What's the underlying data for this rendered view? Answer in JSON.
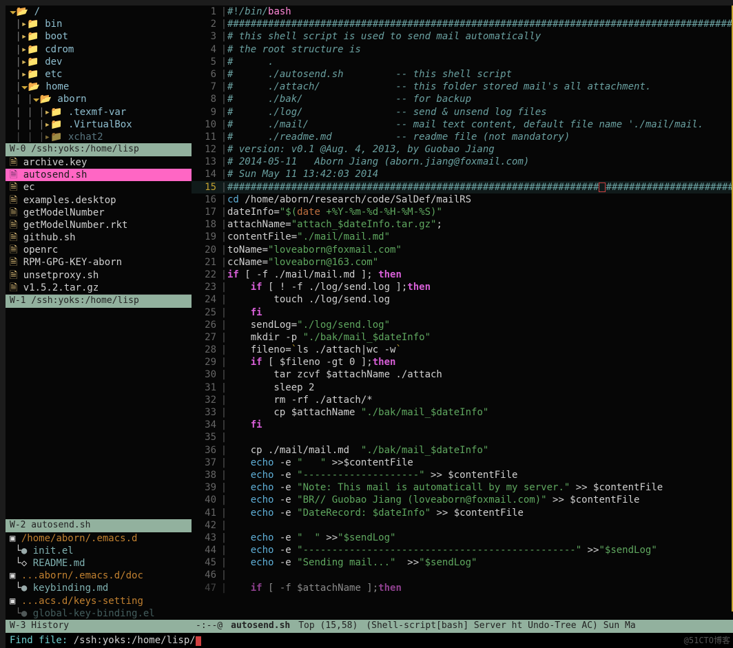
{
  "sidebar": {
    "w0_label": "W-0 /ssh:yoks:/home/lisp",
    "w1_label": "W-1 /ssh:yoks:/home/lisp",
    "w2_label": "W-2 autosend.sh",
    "w3_label": "W-3 History",
    "tree": [
      {
        "depth": 0,
        "icon": "open",
        "name": "/"
      },
      {
        "depth": 1,
        "icon": "closed",
        "name": "bin"
      },
      {
        "depth": 1,
        "icon": "closed",
        "name": "boot"
      },
      {
        "depth": 1,
        "icon": "closed",
        "name": "cdrom"
      },
      {
        "depth": 1,
        "icon": "closed",
        "name": "dev"
      },
      {
        "depth": 1,
        "icon": "closed",
        "name": "etc"
      },
      {
        "depth": 1,
        "icon": "open",
        "name": "home"
      },
      {
        "depth": 2,
        "icon": "open",
        "name": "aborn"
      },
      {
        "depth": 3,
        "icon": "closed",
        "name": ".texmf-var"
      },
      {
        "depth": 3,
        "icon": "closed",
        "name": ".VirtualBox"
      },
      {
        "depth": 3,
        "icon": "closed",
        "name": "xchat2",
        "cut": true
      }
    ],
    "files": [
      {
        "icon": "f",
        "name": "archive.key",
        "sel": false
      },
      {
        "icon": "f",
        "name": "autosend.sh",
        "sel": true
      },
      {
        "icon": "f",
        "name": "ec",
        "sel": false
      },
      {
        "icon": "f",
        "name": "examples.desktop",
        "sel": false
      },
      {
        "icon": "f",
        "name": "getModelNumber",
        "sel": false
      },
      {
        "icon": "f",
        "name": "getModelNumber.rkt",
        "sel": false
      },
      {
        "icon": "f",
        "name": "github.sh",
        "sel": false
      },
      {
        "icon": "f",
        "name": "openrc",
        "sel": false
      },
      {
        "icon": "f",
        "name": "RPM-GPG-KEY-aborn",
        "sel": false
      },
      {
        "icon": "f",
        "name": "unsetproxy.sh",
        "sel": false
      },
      {
        "icon": "f",
        "name": "v1.5.2.tar.gz",
        "sel": false,
        "cut": true
      }
    ],
    "history": [
      {
        "type": "dir",
        "text": "/home/aborn/.emacs.d"
      },
      {
        "type": "file",
        "icon": "dot",
        "text": "init.el"
      },
      {
        "type": "file",
        "icon": "doc",
        "text": "README.md"
      },
      {
        "type": "dir",
        "text": "...aborn/.emacs.d/doc"
      },
      {
        "type": "file",
        "icon": "dot",
        "text": "keybinding.md"
      },
      {
        "type": "dir",
        "text": "...acs.d/keys-setting"
      },
      {
        "type": "file",
        "icon": "dot",
        "text": "global-key-binding.el",
        "cut": true
      }
    ]
  },
  "editor": {
    "lines": [
      {
        "n": 1,
        "segs": [
          {
            "c": "c-hash",
            "t": "#!"
          },
          {
            "c": "c-comment",
            "t": "/bin/"
          },
          {
            "c": "c-mag",
            "t": "bash"
          }
        ]
      },
      {
        "n": 2,
        "segs": [
          {
            "c": "c-hash",
            "t": "#########################################################################################"
          }
        ]
      },
      {
        "n": 3,
        "segs": [
          {
            "c": "c-comment",
            "t": "# this shell script is used to send mail automatically"
          }
        ]
      },
      {
        "n": 4,
        "segs": [
          {
            "c": "c-comment",
            "t": "# the root structure is"
          }
        ]
      },
      {
        "n": 5,
        "segs": [
          {
            "c": "c-comment",
            "t": "#      ."
          }
        ]
      },
      {
        "n": 6,
        "segs": [
          {
            "c": "c-comment",
            "t": "#      ./autosend.sh         -- this shell script"
          }
        ]
      },
      {
        "n": 7,
        "segs": [
          {
            "c": "c-comment",
            "t": "#      ./attach/             -- this folder stored mail's all attachment."
          }
        ]
      },
      {
        "n": 8,
        "segs": [
          {
            "c": "c-comment",
            "t": "#      ./bak/                -- for backup"
          }
        ]
      },
      {
        "n": 9,
        "segs": [
          {
            "c": "c-comment",
            "t": "#      ./log/                -- send & unsend log files"
          }
        ]
      },
      {
        "n": 10,
        "segs": [
          {
            "c": "c-comment",
            "t": "#      ./mail/               -- mail text content, default file name './mail/mail."
          }
        ]
      },
      {
        "n": 11,
        "segs": [
          {
            "c": "c-comment",
            "t": "#      ./readme.md           -- readme file (not mandatory)"
          }
        ]
      },
      {
        "n": 12,
        "segs": [
          {
            "c": "c-comment",
            "t": "# version: v0.1 @Aug. 4, 2013, by Guobao Jiang"
          }
        ]
      },
      {
        "n": 13,
        "segs": [
          {
            "c": "c-comment",
            "t": "# 2014-05-11   Aborn Jiang (aborn.jiang@foxmail.com)"
          }
        ]
      },
      {
        "n": 14,
        "segs": [
          {
            "c": "c-comment",
            "t": "# Sun May 11 13:42:03 2014"
          }
        ]
      },
      {
        "n": 15,
        "hl": true,
        "segs": [
          {
            "c": "c-hash",
            "t": "################################################################"
          },
          {
            "c": "",
            "t": "",
            "redbox": true
          },
          {
            "c": "c-hash",
            "t": "#########################"
          }
        ]
      },
      {
        "n": 16,
        "segs": [
          {
            "c": "c-fn",
            "t": "cd"
          },
          {
            "c": "",
            "t": " /home/aborn/research/code/SalDef/mailRS"
          }
        ]
      },
      {
        "n": 17,
        "segs": [
          {
            "c": "c-var",
            "t": "dateInfo="
          },
          {
            "c": "c-str",
            "t": "\"$("
          },
          {
            "c": "c-orange",
            "t": "date"
          },
          {
            "c": "c-str",
            "t": " +%Y-%m-%d-%H-%M-%S)\""
          }
        ]
      },
      {
        "n": 18,
        "segs": [
          {
            "c": "c-var",
            "t": "attachName="
          },
          {
            "c": "c-str",
            "t": "\"attach_$dateInfo.tar.gz\""
          },
          {
            "c": "",
            "t": ";"
          }
        ]
      },
      {
        "n": 19,
        "segs": [
          {
            "c": "c-var",
            "t": "contentFile="
          },
          {
            "c": "c-str",
            "t": "\"./mail/mail.md\""
          }
        ]
      },
      {
        "n": 20,
        "segs": [
          {
            "c": "c-var",
            "t": "toName="
          },
          {
            "c": "c-str",
            "t": "\"loveaborn@foxmail.com\""
          }
        ]
      },
      {
        "n": 21,
        "segs": [
          {
            "c": "c-var",
            "t": "ccName="
          },
          {
            "c": "c-str",
            "t": "\"loveaborn@163.com\""
          }
        ]
      },
      {
        "n": 22,
        "segs": [
          {
            "c": "c-kw",
            "t": "if"
          },
          {
            "c": "",
            "t": " [ -f ./mail/mail.md ]; "
          },
          {
            "c": "c-kw",
            "t": "then"
          }
        ]
      },
      {
        "n": 23,
        "segs": [
          {
            "c": "",
            "t": "    "
          },
          {
            "c": "c-kw",
            "t": "if"
          },
          {
            "c": "",
            "t": " [ ! -f ./log/send.log ];"
          },
          {
            "c": "c-kw",
            "t": "then"
          }
        ]
      },
      {
        "n": 24,
        "segs": [
          {
            "c": "",
            "t": "        touch ./log/send.log"
          }
        ]
      },
      {
        "n": 25,
        "segs": [
          {
            "c": "",
            "t": "    "
          },
          {
            "c": "c-kw",
            "t": "fi"
          }
        ]
      },
      {
        "n": 26,
        "segs": [
          {
            "c": "",
            "t": "    sendLog="
          },
          {
            "c": "c-str",
            "t": "\"./log/send.log\""
          }
        ]
      },
      {
        "n": 27,
        "segs": [
          {
            "c": "",
            "t": "    mkdir -p "
          },
          {
            "c": "c-str",
            "t": "\"./bak/mail_$dateInfo\""
          }
        ]
      },
      {
        "n": 28,
        "segs": [
          {
            "c": "",
            "t": "    fileno="
          },
          {
            "c": "c-yellow",
            "t": "`"
          },
          {
            "c": "",
            "t": "ls ./attach|wc -w"
          },
          {
            "c": "c-yellow",
            "t": "`"
          }
        ]
      },
      {
        "n": 29,
        "segs": [
          {
            "c": "",
            "t": "    "
          },
          {
            "c": "c-kw",
            "t": "if"
          },
          {
            "c": "",
            "t": " [ $fileno -gt 0 ];"
          },
          {
            "c": "c-kw",
            "t": "then"
          }
        ]
      },
      {
        "n": 30,
        "segs": [
          {
            "c": "",
            "t": "        tar zcvf $attachName ./attach"
          }
        ]
      },
      {
        "n": 31,
        "segs": [
          {
            "c": "",
            "t": "        sleep 2"
          }
        ]
      },
      {
        "n": 32,
        "segs": [
          {
            "c": "",
            "t": "        rm -rf ./attach/*"
          }
        ]
      },
      {
        "n": 33,
        "segs": [
          {
            "c": "",
            "t": "        cp $attachName "
          },
          {
            "c": "c-str",
            "t": "\"./bak/mail_$dateInfo\""
          }
        ]
      },
      {
        "n": 34,
        "segs": [
          {
            "c": "",
            "t": "    "
          },
          {
            "c": "c-kw",
            "t": "fi"
          }
        ]
      },
      {
        "n": 35,
        "segs": [
          {
            "c": "",
            "t": ""
          }
        ]
      },
      {
        "n": 36,
        "segs": [
          {
            "c": "",
            "t": "    cp ./mail/mail.md  "
          },
          {
            "c": "c-str",
            "t": "\"./bak/mail_$dateInfo\""
          }
        ]
      },
      {
        "n": 37,
        "segs": [
          {
            "c": "",
            "t": "    "
          },
          {
            "c": "c-fn",
            "t": "echo"
          },
          {
            "c": "",
            "t": " -e "
          },
          {
            "c": "c-str",
            "t": "\"   \""
          },
          {
            "c": "",
            "t": " >>$contentFile"
          }
        ]
      },
      {
        "n": 38,
        "segs": [
          {
            "c": "",
            "t": "    "
          },
          {
            "c": "c-fn",
            "t": "echo"
          },
          {
            "c": "",
            "t": " -e "
          },
          {
            "c": "c-str",
            "t": "\"--------------------\""
          },
          {
            "c": "",
            "t": " >> $contentFile"
          }
        ]
      },
      {
        "n": 39,
        "segs": [
          {
            "c": "",
            "t": "    "
          },
          {
            "c": "c-fn",
            "t": "echo"
          },
          {
            "c": "",
            "t": " -e "
          },
          {
            "c": "c-str",
            "t": "\"Note: This mail is automaticall by my server.\""
          },
          {
            "c": "",
            "t": " >> $contentFile"
          }
        ]
      },
      {
        "n": 40,
        "segs": [
          {
            "c": "",
            "t": "    "
          },
          {
            "c": "c-fn",
            "t": "echo"
          },
          {
            "c": "",
            "t": " -e "
          },
          {
            "c": "c-str",
            "t": "\"BR// Guobao Jiang (loveaborn@foxmail.com)\""
          },
          {
            "c": "",
            "t": " >> $contentFile"
          }
        ]
      },
      {
        "n": 41,
        "segs": [
          {
            "c": "",
            "t": "    "
          },
          {
            "c": "c-fn",
            "t": "echo"
          },
          {
            "c": "",
            "t": " -e "
          },
          {
            "c": "c-str",
            "t": "\"DateRecord: $dateInfo\""
          },
          {
            "c": "",
            "t": " >> $contentFile"
          }
        ]
      },
      {
        "n": 42,
        "segs": [
          {
            "c": "",
            "t": ""
          }
        ]
      },
      {
        "n": 43,
        "segs": [
          {
            "c": "",
            "t": "    "
          },
          {
            "c": "c-fn",
            "t": "echo"
          },
          {
            "c": "",
            "t": " -e "
          },
          {
            "c": "c-str",
            "t": "\"  \""
          },
          {
            "c": "",
            "t": " >>"
          },
          {
            "c": "c-str",
            "t": "\"$sendLog\""
          }
        ]
      },
      {
        "n": 44,
        "segs": [
          {
            "c": "",
            "t": "    "
          },
          {
            "c": "c-fn",
            "t": "echo"
          },
          {
            "c": "",
            "t": " -e "
          },
          {
            "c": "c-str",
            "t": "\"-----------------------------------------------\""
          },
          {
            "c": "",
            "t": " >>"
          },
          {
            "c": "c-str",
            "t": "\"$sendLog\""
          }
        ]
      },
      {
        "n": 45,
        "segs": [
          {
            "c": "",
            "t": "    "
          },
          {
            "c": "c-fn",
            "t": "echo"
          },
          {
            "c": "",
            "t": " -e "
          },
          {
            "c": "c-str",
            "t": "\"Sending mail...\""
          },
          {
            "c": "",
            "t": "  >>"
          },
          {
            "c": "c-str",
            "t": "\"$sendLog\""
          }
        ]
      },
      {
        "n": 46,
        "segs": [
          {
            "c": "",
            "t": ""
          }
        ]
      },
      {
        "n": 47,
        "segs": [
          {
            "c": "",
            "t": "    "
          },
          {
            "c": "c-kw",
            "t": "if"
          },
          {
            "c": "",
            "t": " [ -f $attachName ];"
          },
          {
            "c": "c-kw",
            "t": "then"
          }
        ],
        "cut": true
      }
    ]
  },
  "modeline_main": {
    "left": "-:--@",
    "buffer": "autosend.sh",
    "pos": "Top (15,58)",
    "modes": "(Shell-script[bash] Server ht Undo-Tree AC) Sun Ma"
  },
  "minibuffer": {
    "prompt": "Find file: ",
    "value": "/ssh:yoks:/home/lisp/"
  },
  "watermark": "@51CTO博客"
}
